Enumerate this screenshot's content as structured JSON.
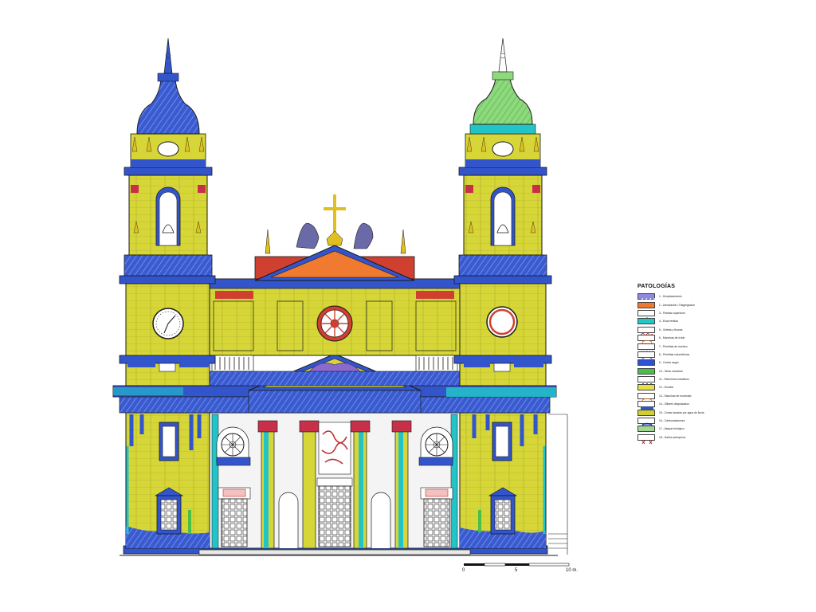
{
  "legend": {
    "title": "PATOLOGÍAS",
    "items": [
      {
        "label": "1.- Desplazaciones",
        "color": "#8a8ae0",
        "pattern": "hatch"
      },
      {
        "label": "2.- Arenización / Disgregación",
        "color": "#f07830",
        "pattern": "solid"
      },
      {
        "label": "3.- Plantas superiores",
        "color": "#ffffff",
        "pattern": "plant"
      },
      {
        "label": "4.- Escorrentías",
        "color": "#20c8c8",
        "pattern": "solid"
      },
      {
        "label": "5.- Grietas y fisuras",
        "color": "#ffffff",
        "pattern": "crack"
      },
      {
        "label": "6.- Manchas de óxido",
        "color": "#ffffff",
        "pattern": "ring"
      },
      {
        "label": "7.- Pérdidas de mortero",
        "color": "#ffffff",
        "pattern": "dash"
      },
      {
        "label": "8.- Pérdidas volumétricas",
        "color": "#ffffff",
        "pattern": "ring-blue"
      },
      {
        "label": "9.- Costra negra",
        "color": "#3050d8",
        "pattern": "solid"
      },
      {
        "label": "10.- Otras manchas",
        "color": "#48c048",
        "pattern": "solid"
      },
      {
        "label": "11.- Elementos metálicos",
        "color": "#ffffff",
        "pattern": "dots"
      },
      {
        "label": "12.- Erosión",
        "color": "#e8e040",
        "pattern": "solid"
      },
      {
        "label": "13.- Manchas de humedad",
        "color": "#ffffff",
        "pattern": "ring"
      },
      {
        "label": "14.- Sillares desplazados",
        "color": "#ffffff",
        "pattern": "bar"
      },
      {
        "label": "15.- Zonas lavadas por agua de lluvia",
        "color": "#cfcf30",
        "pattern": "solid"
      },
      {
        "label": "16.- Carbonataciones",
        "color": "#ffffff",
        "pattern": "oval-blue"
      },
      {
        "label": "17.- Ataque biológico",
        "color": "#a0d890",
        "pattern": "solid"
      },
      {
        "label": "18.- Daños antrópicos",
        "color": "#ffffff",
        "pattern": "cross"
      }
    ]
  },
  "scale_bar": {
    "ticks": [
      "0",
      "5",
      "10 m."
    ]
  },
  "colors": {
    "stone_yellow": "#d6d638",
    "crust_blue": "#3355cc",
    "runoff_cyan": "#22c4c8",
    "orange_arenization": "#f07a30",
    "red_brick": "#d04030",
    "green_bio": "#8ed87e",
    "gold": "#e0c020",
    "outline": "#1a1a1a"
  }
}
